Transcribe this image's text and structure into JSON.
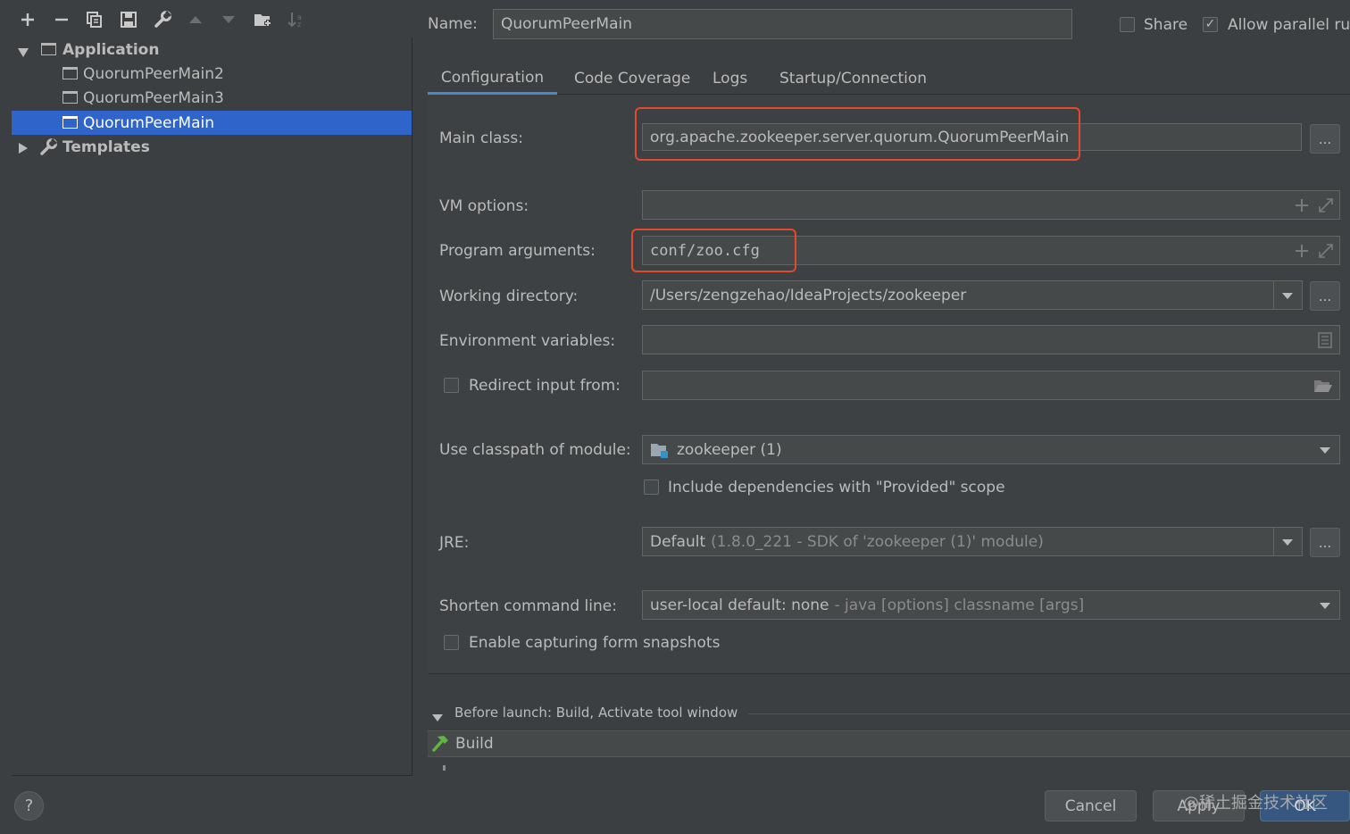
{
  "toolbar": {
    "icons": [
      "plus-icon",
      "minus-icon",
      "copy-icon",
      "save-icon",
      "wrench-icon",
      "arrow-up-icon",
      "arrow-down-icon",
      "folder-add-icon",
      "sort-icon"
    ]
  },
  "tree": {
    "application_label": "Application",
    "items": [
      "QuorumPeerMain2",
      "QuorumPeerMain3",
      "QuorumPeerMain"
    ],
    "templates_label": "Templates"
  },
  "header": {
    "name_label": "Name:",
    "name_value": "QuorumPeerMain",
    "share_label": "Share",
    "allow_parallel_label": "Allow parallel ru",
    "allow_parallel_checked": "✓"
  },
  "tabs": [
    "Configuration",
    "Code Coverage",
    "Logs",
    "Startup/Connection"
  ],
  "form": {
    "main_class_label": "Main class:",
    "main_class_value": "org.apache.zookeeper.server.quorum.QuorumPeerMain",
    "vm_options_label": "VM options:",
    "program_args_label": "Program arguments:",
    "program_args_value": "conf/zoo.cfg",
    "working_dir_label": "Working directory:",
    "working_dir_value": "/Users/zengzehao/IdeaProjects/zookeeper",
    "env_vars_label": "Environment variables:",
    "redirect_label": "Redirect input from:",
    "classpath_label": "Use classpath of module:",
    "classpath_value": "zookeeper (1)",
    "include_deps_label": "Include dependencies with \"Provided\" scope",
    "jre_label": "JRE:",
    "jre_value_main": "Default",
    "jre_value_detail": "(1.8.0_221 - SDK of 'zookeeper (1)' module)",
    "shorten_label": "Shorten command line:",
    "shorten_value_main": "user-local default: none",
    "shorten_value_detail": "- java [options] classname [args]",
    "snapshots_label": "Enable capturing form snapshots",
    "dots": "..."
  },
  "before_launch": {
    "title": "Before launch: Build, Activate tool window",
    "item": "Build"
  },
  "buttons": {
    "help": "?",
    "cancel": "Cancel",
    "apply": "Apply",
    "ok": "OK"
  },
  "watermark": "@稀土掘金技术社区",
  "colors": {
    "background": "#3c3f41",
    "selection": "#2f65ca",
    "highlight_box": "#e2492d",
    "tab_underline": "#4a88c7"
  }
}
